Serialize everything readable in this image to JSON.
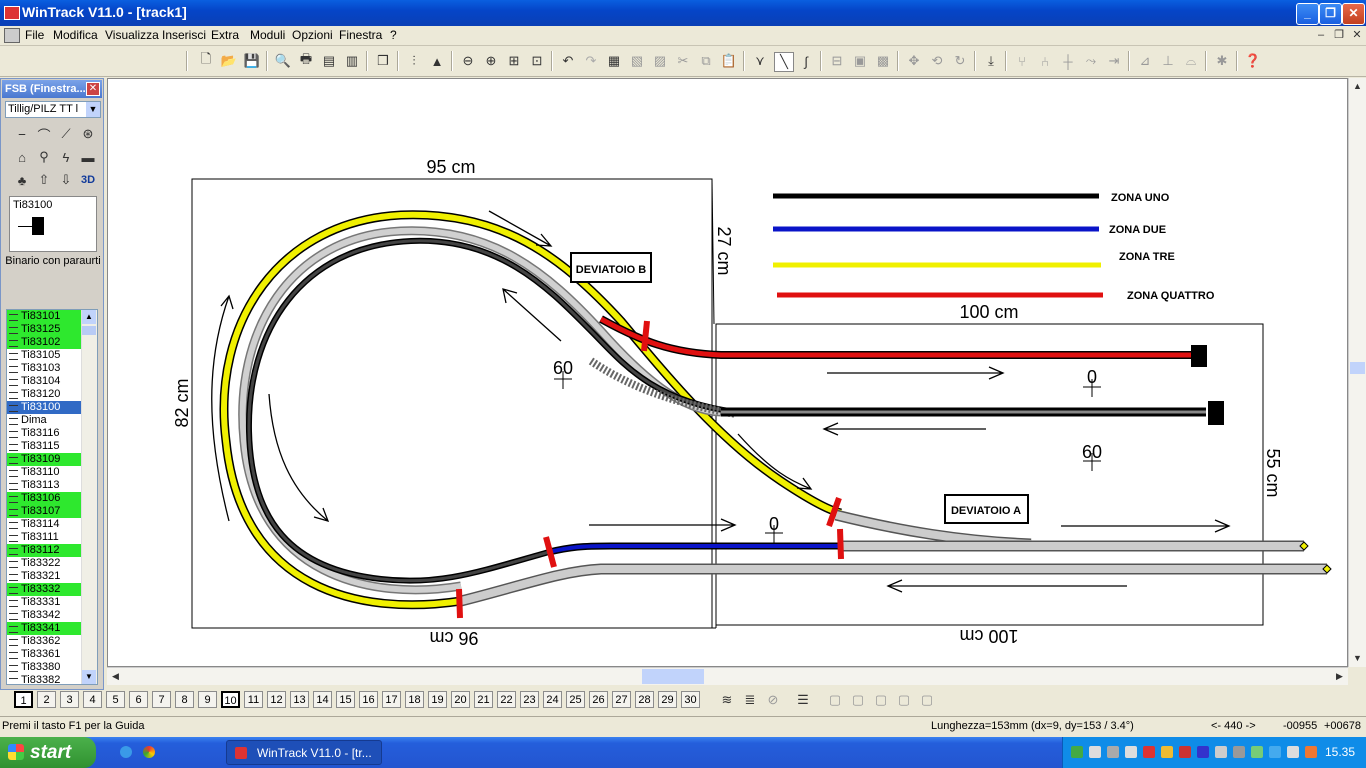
{
  "window": {
    "title": "WinTrack  V11.0 - [track1]"
  },
  "menu": [
    "File",
    "Modifica",
    "Visualizza",
    "Inserisci",
    "Extra",
    "Moduli",
    "Opzioni",
    "Finestra",
    "?"
  ],
  "panel": {
    "title": "FSB (Finestra...",
    "library": "Tillig/PILZ  TT l",
    "preview_code": "Ti83100",
    "preview_desc": "Binario con paraurti",
    "items": [
      {
        "label": "Ti83101",
        "state": "green"
      },
      {
        "label": "Ti83125",
        "state": "green"
      },
      {
        "label": "Ti83102",
        "state": "green"
      },
      {
        "label": "Ti83105",
        "state": ""
      },
      {
        "label": "Ti83103",
        "state": ""
      },
      {
        "label": "Ti83104",
        "state": ""
      },
      {
        "label": "Ti83120",
        "state": ""
      },
      {
        "label": "Ti83100",
        "state": "selected"
      },
      {
        "label": "Dima",
        "state": ""
      },
      {
        "label": "Ti83116",
        "state": ""
      },
      {
        "label": "Ti83115",
        "state": ""
      },
      {
        "label": "Ti83109",
        "state": "green"
      },
      {
        "label": "Ti83110",
        "state": ""
      },
      {
        "label": "Ti83113",
        "state": ""
      },
      {
        "label": "Ti83106",
        "state": "green"
      },
      {
        "label": "Ti83107",
        "state": "green"
      },
      {
        "label": "Ti83114",
        "state": ""
      },
      {
        "label": "Ti83111",
        "state": ""
      },
      {
        "label": "Ti83112",
        "state": "green"
      },
      {
        "label": "Ti83322",
        "state": ""
      },
      {
        "label": "Ti83321",
        "state": ""
      },
      {
        "label": "Ti83332",
        "state": "green"
      },
      {
        "label": "Ti83331",
        "state": ""
      },
      {
        "label": "Ti83342",
        "state": ""
      },
      {
        "label": "Ti83341",
        "state": "green"
      },
      {
        "label": "Ti83362",
        "state": ""
      },
      {
        "label": "Ti83361",
        "state": ""
      },
      {
        "label": "Ti83380",
        "state": ""
      },
      {
        "label": "Ti83382",
        "state": ""
      }
    ]
  },
  "drawing": {
    "dim_top_left": "95 cm",
    "dim_right_small": "27 cm",
    "dim_top_right": "100 cm",
    "dim_left": "82 cm",
    "dim_right": "55 cm",
    "dim_bottom_left": "96 cm",
    "dim_bottom_right": "100 cm",
    "legend": [
      {
        "label": "ZONA UNO",
        "color": "#000000"
      },
      {
        "label": "ZONA DUE",
        "color": "#0a14c8"
      },
      {
        "label": "ZONA TRE",
        "color": "#f0f000"
      },
      {
        "label": "ZONA QUATTRO",
        "color": "#e01010"
      }
    ],
    "label_deviatoio_b": "DEVIATOIO B",
    "label_deviatoio_a": "DEVIATOIO A",
    "height_marks": [
      "60",
      "0",
      "60",
      "0"
    ]
  },
  "pages": [
    "1",
    "2",
    "3",
    "4",
    "5",
    "6",
    "7",
    "8",
    "9",
    "10",
    "11",
    "12",
    "13",
    "14",
    "15",
    "16",
    "17",
    "18",
    "19",
    "20",
    "21",
    "22",
    "23",
    "24",
    "25",
    "26",
    "27",
    "28",
    "29",
    "30"
  ],
  "status": {
    "help": "Premi il tasto F1 per la Guida",
    "measure": "Lunghezza=153mm (dx=9, dy=153 / 3.4°)",
    "coord_a": "<- 440 ->",
    "coord_b": "-00955",
    "coord_c": "+00678"
  },
  "taskbar": {
    "start": "start",
    "item": "WinTrack  V11.0 - [tr...",
    "clock": "15.35"
  },
  "colors": {
    "zone1": "#000000",
    "zone2": "#0a14c8",
    "zone3": "#f0f000",
    "zone4": "#e01010",
    "selected": "#316ac5",
    "green": "#2ee82e"
  }
}
